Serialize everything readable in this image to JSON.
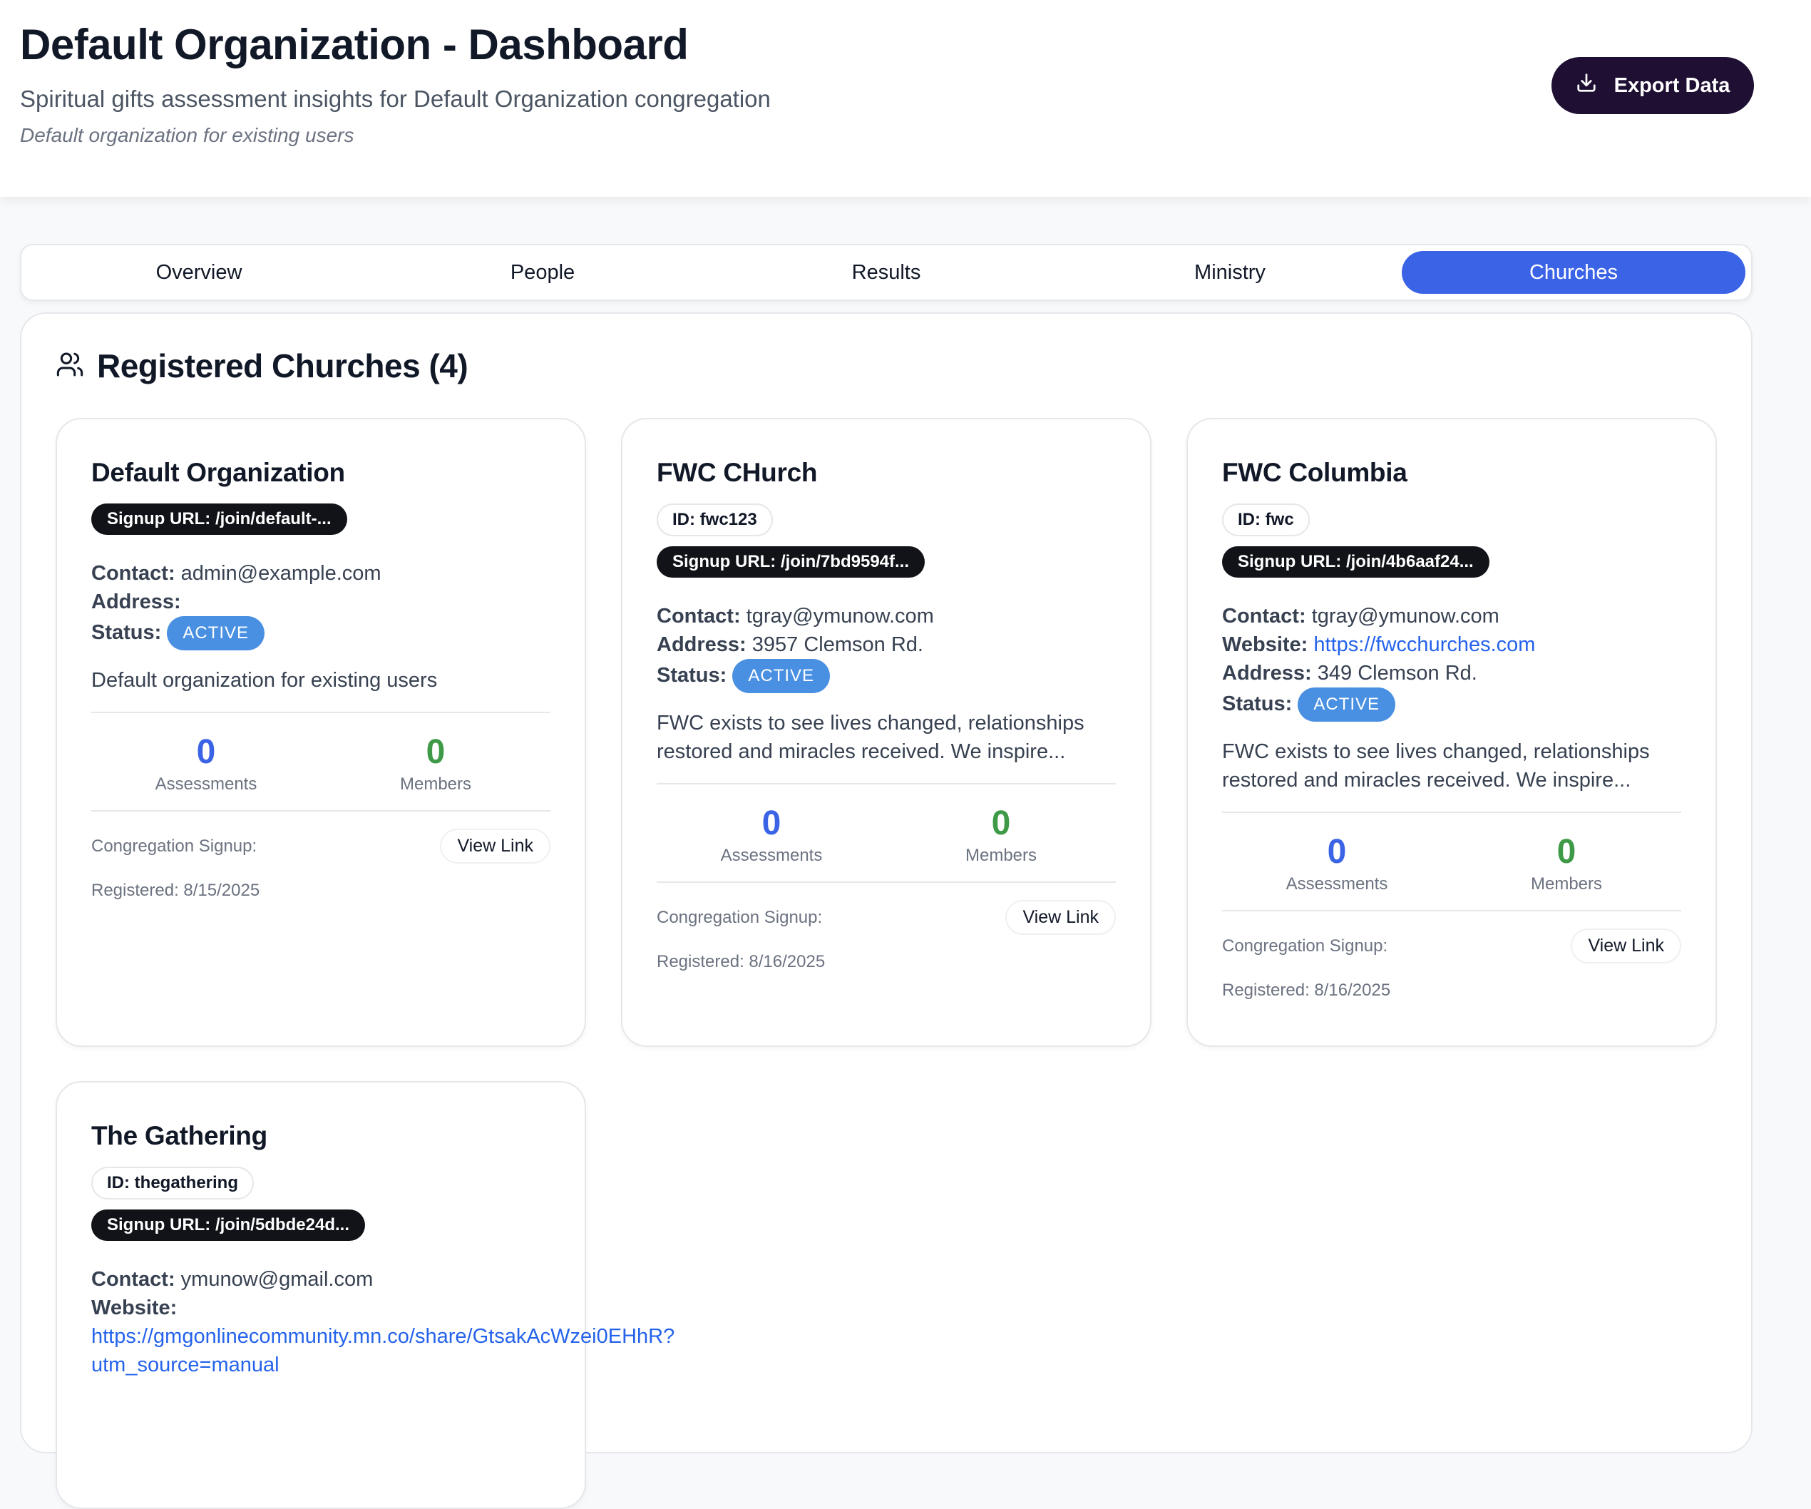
{
  "header": {
    "title": "Default Organization - Dashboard",
    "subtitle": "Spiritual gifts assessment insights for Default Organization congregation",
    "tagline": "Default organization for existing users",
    "export_label": "Export Data"
  },
  "tabs": [
    {
      "label": "Overview"
    },
    {
      "label": "People"
    },
    {
      "label": "Results"
    },
    {
      "label": "Ministry"
    },
    {
      "label": "Churches",
      "active": true
    }
  ],
  "panel": {
    "title": "Registered Churches (4)"
  },
  "labels": {
    "contact": "Contact:",
    "website": "Website:",
    "address": "Address:",
    "status": "Status:",
    "assessments": "Assessments",
    "members": "Members",
    "congregation_signup": "Congregation Signup:",
    "view_link": "View Link"
  },
  "churches": [
    {
      "name": "Default Organization",
      "signup_url": "Signup URL: /join/default-...",
      "contact": "admin@example.com",
      "address": "",
      "status": "ACTIVE",
      "description": "Default organization for existing users",
      "assessments": "0",
      "members": "0",
      "registered": "Registered: 8/15/2025"
    },
    {
      "name": "FWC CHurch",
      "id": "ID: fwc123",
      "signup_url": "Signup URL: /join/7bd9594f...",
      "contact": "tgray@ymunow.com",
      "address": "3957 Clemson Rd.",
      "status": "ACTIVE",
      "description_line1": "FWC exists to see lives changed, relationships",
      "description_line2": "restored and miracles received. We inspire...",
      "assessments": "0",
      "members": "0",
      "registered": "Registered: 8/16/2025"
    },
    {
      "name": "FWC Columbia",
      "id": "ID: fwc",
      "signup_url": "Signup URL: /join/4b6aaf24...",
      "contact": "tgray@ymunow.com",
      "website": "https://fwcchurches.com",
      "address": "349 Clemson Rd.",
      "status": "ACTIVE",
      "description_line1": "FWC exists to see lives changed, relationships",
      "description_line2": "restored and miracles received. We inspire...",
      "assessments": "0",
      "members": "0",
      "registered": "Registered: 8/16/2025"
    },
    {
      "name": "The Gathering",
      "id": "ID: thegathering",
      "signup_url": "Signup URL: /join/5dbde24d...",
      "contact": "ymunow@gmail.com",
      "website_line1": "https://gmgonlinecommunity.mn.co/share/GtsakAcWzei0EHhR?",
      "website_line2": "utm_source=manual"
    }
  ]
}
